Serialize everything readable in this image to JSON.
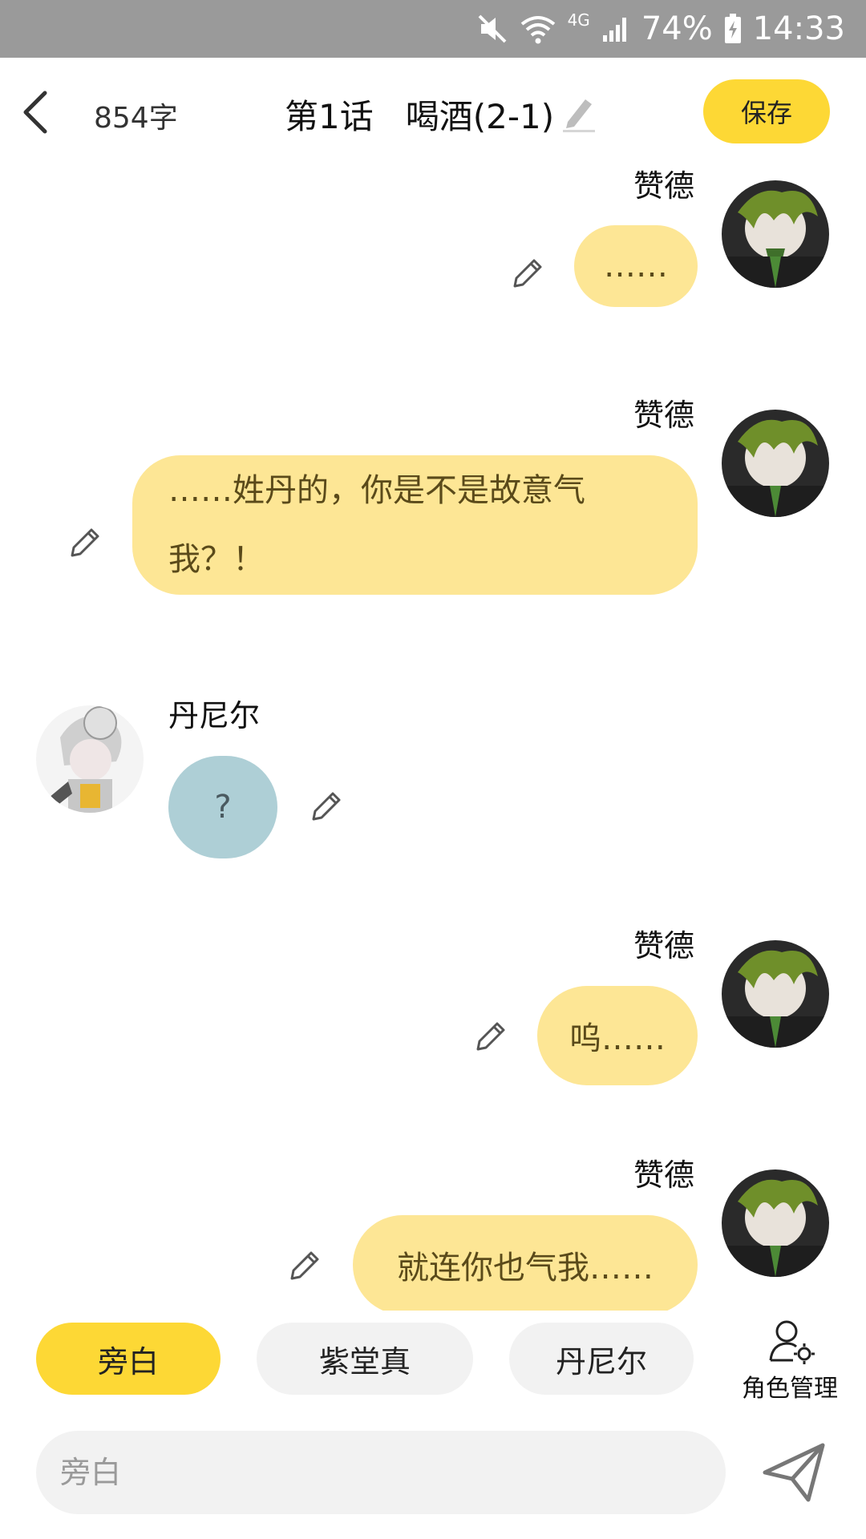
{
  "status_bar": {
    "network": "4G",
    "battery": "74%",
    "time": "14:33"
  },
  "header": {
    "word_count": "854字",
    "title": "第1话   喝酒(2-1)",
    "save_label": "保存"
  },
  "messages": [
    {
      "speaker": "赞德",
      "side": "right",
      "text": "……",
      "style": "yellow"
    },
    {
      "speaker": "赞德",
      "side": "right",
      "text_lines": [
        "……姓丹的，你是不是故意气",
        "我？！"
      ],
      "style": "yellow"
    },
    {
      "speaker": "丹尼尔",
      "side": "left",
      "text": "?",
      "style": "blue"
    },
    {
      "speaker": "赞德",
      "side": "right",
      "text": "呜……",
      "style": "yellow"
    },
    {
      "speaker": "赞德",
      "side": "right",
      "text": "就连你也气我……",
      "style": "yellow"
    }
  ],
  "roles": {
    "chips": [
      "旁白",
      "紫堂真",
      "丹尼尔"
    ],
    "active": "旁白",
    "manage_label": "角色管理"
  },
  "input": {
    "placeholder": "旁白"
  },
  "colors": {
    "accent": "#fdd835",
    "bubble_right": "#fde695",
    "bubble_left": "#aecfd6",
    "status_bar": "#9a9a9a"
  },
  "icons": [
    "mute-icon",
    "wifi-icon",
    "signal-icon",
    "battery-icon",
    "back-arrow-icon",
    "pencil-icon",
    "role-settings-icon",
    "send-icon"
  ]
}
